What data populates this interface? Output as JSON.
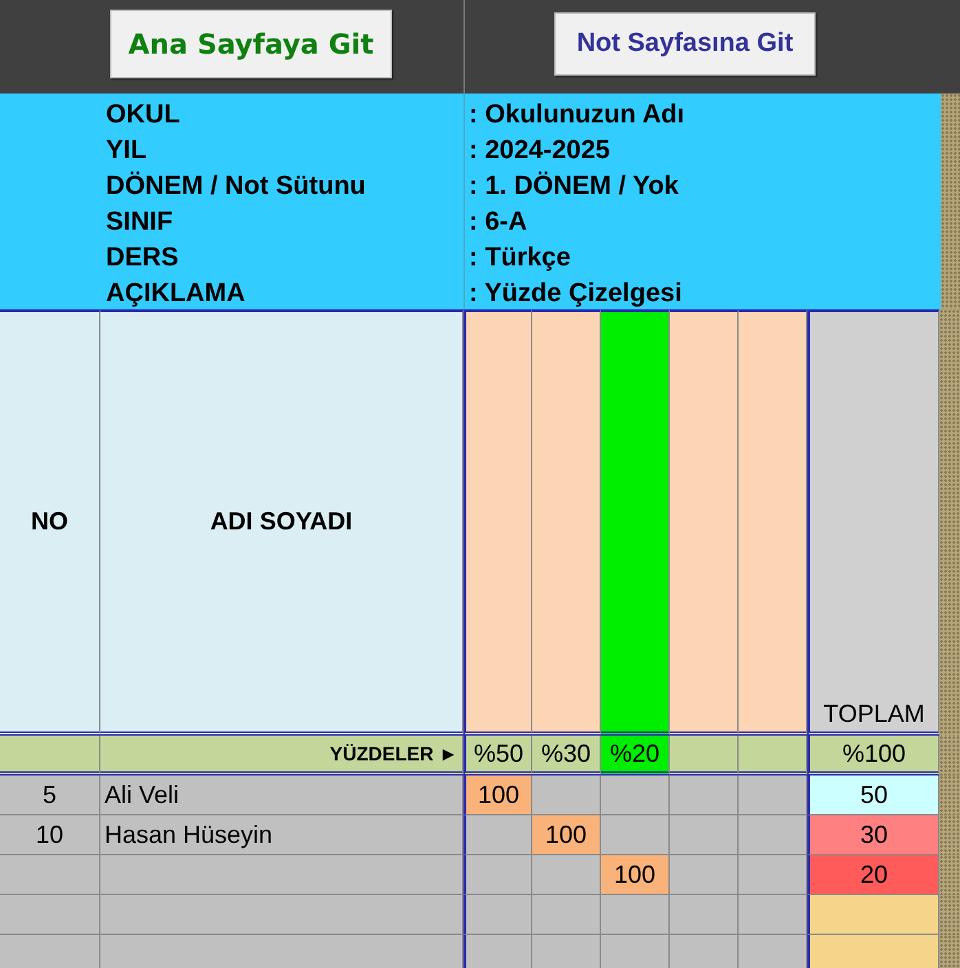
{
  "buttons": [
    {
      "label": "Ana Sayfaya Git",
      "kind": "home"
    },
    {
      "label": "Not Sayfasına Git",
      "kind": "notes"
    }
  ],
  "info": [
    {
      "label": "OKUL",
      "value": ": Okulunuzun Adı"
    },
    {
      "label": "YIL",
      "value": ": 2024-2025"
    },
    {
      "label": "DÖNEM / Not Sütunu",
      "value": ": 1. DÖNEM / Yok"
    },
    {
      "label": "SINIF",
      "value": ": 6-A"
    },
    {
      "label": "DERS",
      "value": ": Türkçe"
    },
    {
      "label": "AÇIKLAMA",
      "value": ": Yüzde Çizelgesi"
    }
  ],
  "header": {
    "no": "NO",
    "name": "ADI SOYADI",
    "total": "TOPLAM",
    "columns": [
      {
        "selected": false
      },
      {
        "selected": false
      },
      {
        "selected": true
      },
      {
        "selected": false
      },
      {
        "selected": false
      }
    ]
  },
  "percent_row": {
    "label": "YÜZDELER ►",
    "values": {
      "column_1": "%50",
      "column_2": "%30",
      "column_3": "%20"
    },
    "total": "%100"
  },
  "rows": [
    {
      "no": "5",
      "name": "Ali Veli",
      "scores": {
        "column_1": "100"
      },
      "total": "50",
      "color": "#ccffff"
    },
    {
      "no": "10",
      "name": "Hasan Hüseyin",
      "scores": {
        "column_2": "100"
      },
      "total": "30",
      "color": "#ff8080"
    },
    {
      "scores": {
        "column_3": "100"
      },
      "total": "20",
      "color": "#ff5b5b"
    },
    {
      "color": "#f5d58a"
    },
    {
      "color": "#f5d58a"
    }
  ]
}
